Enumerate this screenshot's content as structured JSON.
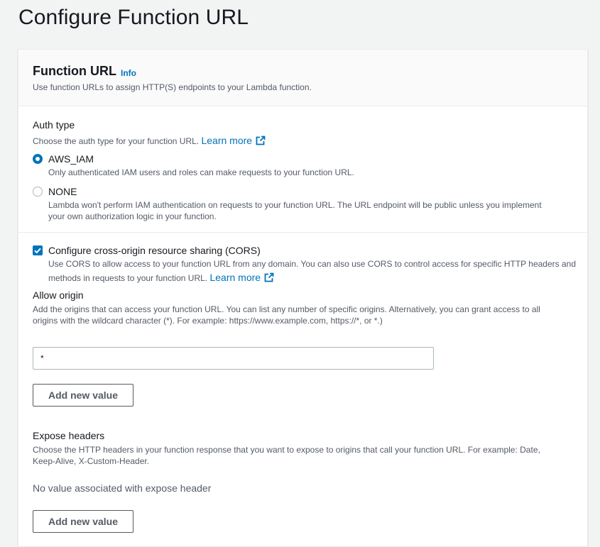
{
  "page": {
    "title": "Configure Function URL"
  },
  "function_url_panel": {
    "title": "Function URL",
    "info_label": "Info",
    "description": "Use function URLs to assign HTTP(S) endpoints to your Lambda function."
  },
  "auth_type": {
    "label": "Auth type",
    "description": "Choose the auth type for your function URL.",
    "learn_more": "Learn more",
    "selected": "AWS_IAM",
    "options": [
      {
        "label": "AWS_IAM",
        "description": "Only authenticated IAM users and roles can make requests to your function URL.",
        "checked": true
      },
      {
        "label": "NONE",
        "description_line1": "Lambda won't perform IAM authentication on requests to your function URL. The URL endpoint will be public unless you implement",
        "description_line2": "your own authorization logic in your function.",
        "checked": false
      }
    ]
  },
  "cors": {
    "checkbox_label": "Configure cross-origin resource sharing (CORS)",
    "checked": true,
    "description_line1": "Use CORS to allow access to your function URL from any domain. You can also use CORS to control access for specific HTTP headers and",
    "description_line2": "methods in requests to your function URL.",
    "learn_more": "Learn more"
  },
  "allow_origin": {
    "label": "Allow origin",
    "description_line1": "Add the origins that can access your function URL. You can list any number of specific origins. Alternatively, you can grant access to all",
    "description_line2": "origins with the wildcard character (*). For example: https://www.example.com, https://*, or *.)",
    "value": "*",
    "add_button": "Add new value"
  },
  "expose_headers": {
    "label": "Expose headers",
    "description_line1": "Choose the HTTP headers in your function response that you want to expose to origins that call your function URL. For example: Date,",
    "description_line2": "Keep-Alive, X-Custom-Header.",
    "empty_text": "No value associated with expose header",
    "add_button": "Add new value"
  },
  "colors": {
    "accent": "#0073bb",
    "text": "#16191f",
    "muted": "#545b64",
    "background": "#f2f3f3"
  },
  "icons": {
    "external_link": "external-link-icon",
    "checkmark": "checkmark-icon"
  }
}
